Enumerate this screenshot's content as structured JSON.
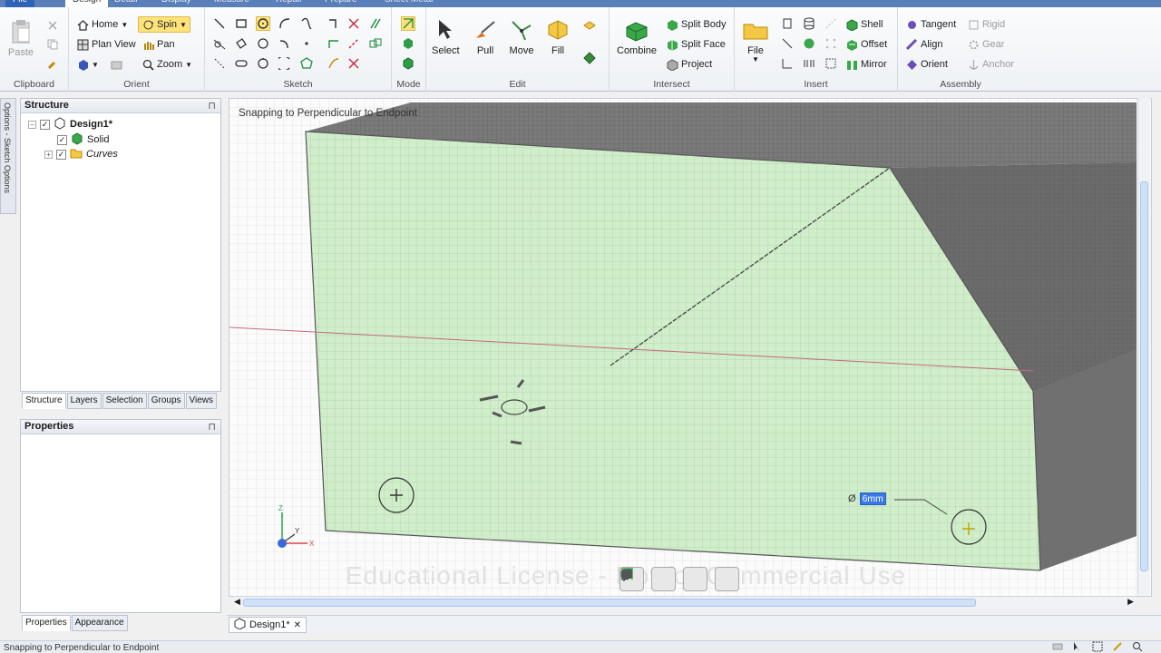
{
  "ribbon_tabs": [
    "File",
    "Design",
    "Detail",
    "Display",
    "Measure",
    "Repair",
    "Prepare",
    "Sheet Metal"
  ],
  "ribbon": {
    "clipboard": {
      "label": "Clipboard",
      "paste": "Paste"
    },
    "orient": {
      "label": "Orient",
      "home": "Home",
      "plan_view": "Plan View",
      "spin": "Spin",
      "pan": "Pan",
      "zoom": "Zoom"
    },
    "sketch": {
      "label": "Sketch"
    },
    "mode": {
      "label": "Mode"
    },
    "edit": {
      "label": "Edit",
      "select": "Select",
      "pull": "Pull",
      "move": "Move",
      "fill": "Fill"
    },
    "intersect": {
      "label": "Intersect",
      "combine": "Combine",
      "split_body": "Split Body",
      "split_face": "Split Face",
      "project": "Project"
    },
    "insert": {
      "label": "Insert",
      "file": "File",
      "shell": "Shell",
      "offset": "Offset",
      "mirror": "Mirror"
    },
    "assembly": {
      "label": "Assembly",
      "tangent": "Tangent",
      "align": "Align",
      "orient": "Orient",
      "rigid": "Rigid",
      "gear": "Gear",
      "anchor": "Anchor"
    }
  },
  "left_strip": "Options - Sketch Options",
  "structure": {
    "title": "Structure",
    "tree": [
      {
        "label": "Design1*"
      },
      {
        "label": "Solid"
      },
      {
        "label": "Curves"
      }
    ]
  },
  "panel_tabs": [
    "Structure",
    "Layers",
    "Selection",
    "Groups",
    "Views"
  ],
  "properties": {
    "title": "Properties"
  },
  "bottom_tabs": [
    "Properties",
    "Appearance"
  ],
  "viewport": {
    "hint": "Snapping to Perpendicular to Endpoint",
    "dimension_symbol": "Ø",
    "dimension_value": "6mm",
    "watermark": "Educational License - Not for Commercial Use",
    "colors": {
      "face": "#cfeec9",
      "dark_face": "#6b6b6b",
      "grid": "#9aa39a"
    }
  },
  "doc_tab": {
    "label": "Design1*"
  },
  "status": {
    "text": "Snapping to Perpendicular to Endpoint"
  }
}
